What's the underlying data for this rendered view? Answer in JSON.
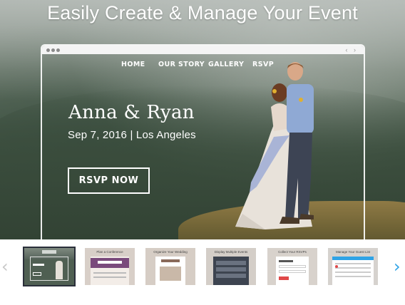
{
  "headline": "Easily Create & Manage Your Event",
  "site": {
    "nav": [
      "HOME",
      "OUR STORY",
      "GALLERY",
      "RSVP"
    ],
    "couple": "Anna & Ryan",
    "date_location": "Sep 7, 2016 | Los Angeles",
    "rsvp_button": "RSVP NOW"
  },
  "carousel": {
    "prev_icon": "chevron-left-icon",
    "next_icon": "chevron-right-icon",
    "arrow_color": "#2fa3e6",
    "thumbnails": [
      {
        "caption": "",
        "active": true
      },
      {
        "caption": "Plan a Conference",
        "active": false
      },
      {
        "caption": "Organize Your Wedding",
        "active": false
      },
      {
        "caption": "Display Multiple Events",
        "active": false
      },
      {
        "caption": "Collect Your RSVPs",
        "active": false
      },
      {
        "caption": "Manage Your Guest List",
        "active": false
      }
    ]
  }
}
